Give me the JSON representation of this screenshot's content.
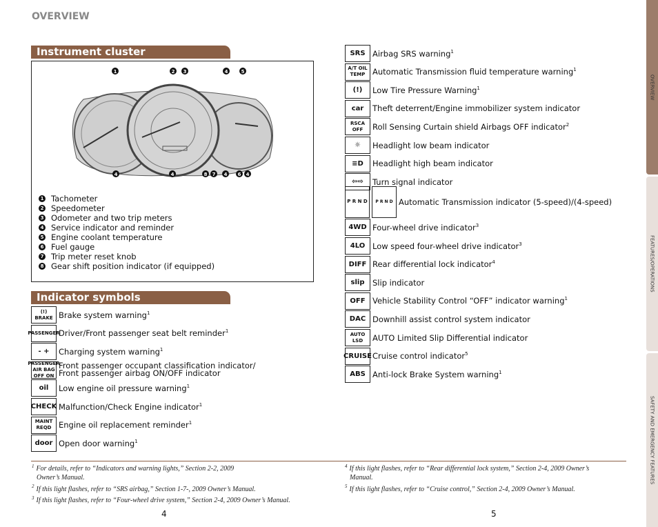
{
  "header": "OVERVIEW",
  "cluster": {
    "title": "Instrument cluster",
    "callouts_top": [
      "1",
      "2",
      "3",
      "4",
      "5"
    ],
    "callouts_bottom": [
      "4",
      "4",
      "8",
      "7",
      "4",
      "6",
      "4"
    ],
    "legend": [
      {
        "n": "1",
        "label": "Tachometer"
      },
      {
        "n": "2",
        "label": "Speedometer"
      },
      {
        "n": "3",
        "label": "Odometer and two trip meters"
      },
      {
        "n": "4",
        "label": "Service indicator and reminder"
      },
      {
        "n": "5",
        "label": "Engine coolant temperature"
      },
      {
        "n": "6",
        "label": "Fuel gauge"
      },
      {
        "n": "7",
        "label": "Trip meter reset knob"
      },
      {
        "n": "8",
        "label": "Gear shift position indicator (if equipped)"
      }
    ]
  },
  "indicators": {
    "title": "Indicator symbols",
    "left": [
      {
        "icon": "brake-warning-icon",
        "icon_text": "(!) BRAKE",
        "label": "Brake system warning",
        "sup": "1"
      },
      {
        "icon": "seat-belt-icon",
        "icon_text": "PASSENGER",
        "label": "Driver/Front passenger seat belt reminder",
        "sup": "1"
      },
      {
        "icon": "battery-icon",
        "icon_text": "- +",
        "label": "Charging system warning",
        "sup": "1"
      },
      {
        "icon": "passenger-airbag-icon",
        "icon_text": "PASSENGER AIR BAG OFF ON",
        "label": "Front passenger occupant classification indicator/",
        "label2": "Front passenger airbag ON/OFF indicator",
        "sup": ""
      },
      {
        "icon": "oil-pressure-icon",
        "icon_text": "oil",
        "label": "Low engine oil pressure warning",
        "sup": "1"
      },
      {
        "icon": "check-engine-icon",
        "icon_text": "CHECK",
        "label": "Malfunction/Check Engine indicator",
        "sup": "1"
      },
      {
        "icon": "maint-reqd-icon",
        "icon_text": "MAINT REQD",
        "label": "Engine oil replacement reminder",
        "sup": "1"
      },
      {
        "icon": "open-door-icon",
        "icon_text": "door",
        "label": "Open door warning",
        "sup": "1"
      }
    ],
    "right": [
      {
        "icon": "airbag-srs-icon",
        "icon_text": "SRS",
        "label": "Airbag SRS warning",
        "sup": "1"
      },
      {
        "icon": "at-oil-temp-icon",
        "icon_text": "A/T OIL TEMP",
        "label": "Automatic Transmission fluid temperature warning",
        "sup": "1"
      },
      {
        "icon": "tire-pressure-icon",
        "icon_text": "(!)",
        "label": "Low Tire Pressure Warning",
        "sup": "1"
      },
      {
        "icon": "theft-deterrent-icon",
        "icon_text": "car",
        "label": "Theft deterrent/Engine immobilizer system indicator",
        "sup": ""
      },
      {
        "icon": "rsca-off-icon",
        "icon_text": "RSCA OFF",
        "label": "Roll Sensing Curtain shield Airbags OFF indicator",
        "sup": "2"
      },
      {
        "icon": "headlight-low-icon",
        "icon_text": "☼",
        "label": "Headlight low beam indicator",
        "sup": ""
      },
      {
        "icon": "headlight-high-icon",
        "icon_text": "≡D",
        "label": "Headlight high beam indicator",
        "sup": ""
      },
      {
        "icon": "turn-signal-icon",
        "icon_text": "⇦⇨",
        "label": "Turn signal indicator",
        "sup": ""
      },
      {
        "icon": "transmission-indicator-icon",
        "icon_text": "P R N D",
        "label": "Automatic Transmission indicator (5-speed)/(4-speed)",
        "sup": ""
      },
      {
        "icon": "four-wheel-drive-icon",
        "icon_text": "4WD",
        "label": "Four-wheel drive indicator",
        "sup": "3"
      },
      {
        "icon": "4lo-icon",
        "icon_text": "4LO",
        "label": "Low speed four-wheel drive indicator",
        "sup": "3"
      },
      {
        "icon": "rear-diff-lock-icon",
        "icon_text": "DIFF",
        "label": "Rear differential lock indicator",
        "sup": "4"
      },
      {
        "icon": "slip-icon",
        "icon_text": "slip",
        "label": "Slip indicator",
        "sup": ""
      },
      {
        "icon": "vsc-off-icon",
        "icon_text": "OFF",
        "label": "Vehicle Stability Control “OFF” indicator warning",
        "sup": "1"
      },
      {
        "icon": "downhill-assist-icon",
        "icon_text": "DAC",
        "label": "Downhill assist control system indicator",
        "sup": ""
      },
      {
        "icon": "auto-lsd-icon",
        "icon_text": "AUTO LSD",
        "label": "AUTO Limited Slip Differential indicator",
        "sup": ""
      },
      {
        "icon": "cruise-icon",
        "icon_text": "CRUISE",
        "label": "Cruise control indicator",
        "sup": "5"
      },
      {
        "icon": "abs-icon",
        "icon_text": "ABS",
        "label": "Anti-lock Brake System warning",
        "sup": "1"
      }
    ]
  },
  "footnotes_left": [
    {
      "n": "1",
      "text": "For details, refer to “Indicators and warning lights,” Section 2-2, 2009",
      "text2": "Owner’s Manual."
    },
    {
      "n": "2",
      "text": "If this light flashes, refer to “SRS airbag,” Section 1-7-, 2009 Owner’s Manual."
    },
    {
      "n": "3",
      "text": "If this light flashes, refer to “Four-wheel drive system,” Section 2-4, 2009 Owner’s Manual."
    }
  ],
  "footnotes_right": [
    {
      "n": "4",
      "text": "If this light flashes, refer to “Rear differential lock system,” Section 2-4, 2009 Owner’s",
      "text2": "Manual."
    },
    {
      "n": "5",
      "text": "If this light flashes, refer to “Cruise control,” Section 2-4, 2009 Owner’s Manual."
    }
  ],
  "pages": [
    "4",
    "5"
  ],
  "tabs": [
    "OVERVIEW",
    "FEATURES/OPERATIONS",
    "SAFETY AND EMERGENCY FEATURES"
  ],
  "colors": {
    "accent": "#8a5f45",
    "tab_active": "#9c7d6a",
    "tab_inactive": "#e8e0db"
  }
}
